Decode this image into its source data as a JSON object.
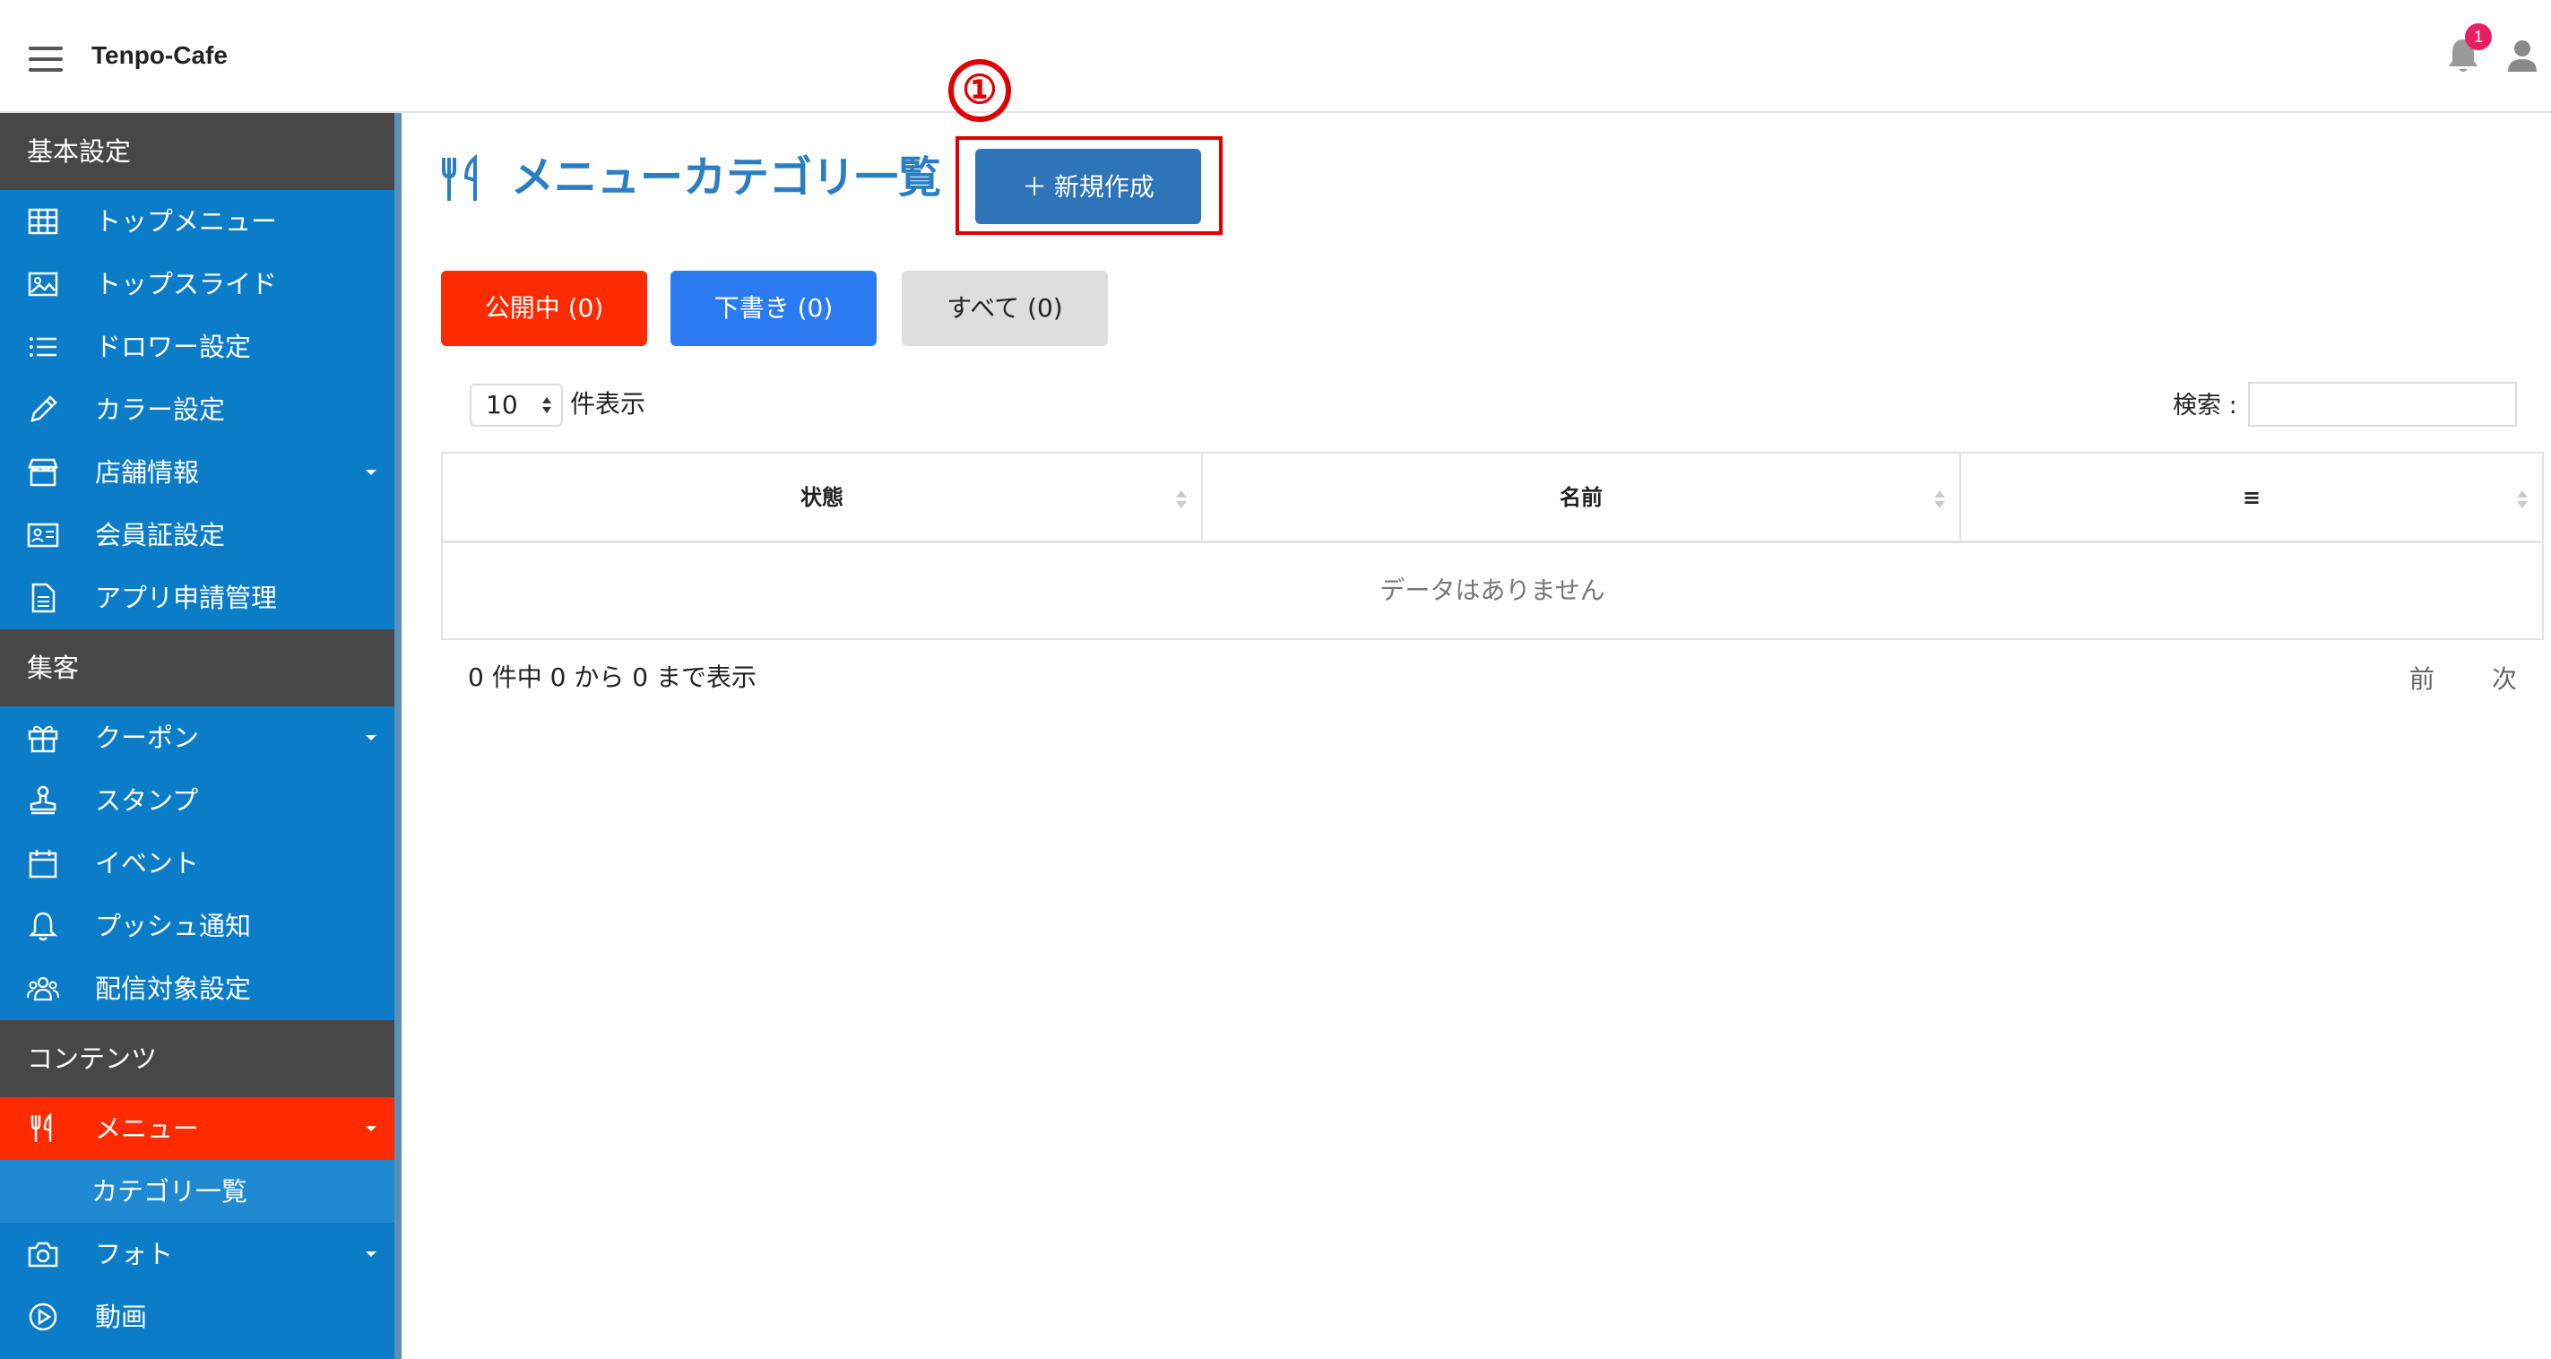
{
  "header": {
    "app_title": "Tenpo-Cafe",
    "notification_count": "1"
  },
  "sidebar": {
    "sections": [
      {
        "title": "基本設定",
        "items": [
          {
            "label": "トップメニュー",
            "icon": "grid-icon"
          },
          {
            "label": "トップスライド",
            "icon": "image-icon"
          },
          {
            "label": "ドロワー設定",
            "icon": "list-icon"
          },
          {
            "label": "カラー設定",
            "icon": "pencil-icon"
          },
          {
            "label": "店舗情報",
            "icon": "store-icon",
            "has_submenu": true
          },
          {
            "label": "会員証設定",
            "icon": "id-card-icon"
          },
          {
            "label": "アプリ申請管理",
            "icon": "document-icon"
          }
        ]
      },
      {
        "title": "集客",
        "items": [
          {
            "label": "クーポン",
            "icon": "gift-icon",
            "has_submenu": true
          },
          {
            "label": "スタンプ",
            "icon": "stamp-icon"
          },
          {
            "label": "イベント",
            "icon": "calendar-icon"
          },
          {
            "label": "プッシュ通知",
            "icon": "bell-icon"
          },
          {
            "label": "配信対象設定",
            "icon": "users-icon"
          }
        ]
      },
      {
        "title": "コンテンツ",
        "items": [
          {
            "label": "メニュー",
            "icon": "fork-knife-icon",
            "has_submenu": true,
            "active": true
          },
          {
            "label": "カテゴリ一覧",
            "submenu": true
          },
          {
            "label": "フォト",
            "icon": "camera-icon",
            "has_submenu": true
          },
          {
            "label": "動画",
            "icon": "play-icon"
          }
        ]
      }
    ]
  },
  "main": {
    "title": "メニューカテゴリ一覧",
    "new_button_label": "＋ 新規作成",
    "annotation": "①",
    "tabs": [
      {
        "label": "公開中 (0)"
      },
      {
        "label": "下書き (0)"
      },
      {
        "label": "すべて (0)"
      }
    ],
    "page_length": "10",
    "page_length_label": "件表示",
    "search_label": "検索 :",
    "search_value": "",
    "table": {
      "columns": [
        "状態",
        "名前",
        "≡"
      ],
      "empty_message": "データはありません"
    },
    "info": "0 件中 0 から 0 まで表示",
    "pager": {
      "prev": "前",
      "next": "次"
    }
  },
  "colors": {
    "sidebar_bg": "#0b7cc7",
    "section_header_bg": "#474747",
    "active_item_bg": "#ff2b00",
    "title_color": "#2a7fc4",
    "primary_button": "#2e74b8",
    "published_tab": "#ff2b00",
    "draft_tab": "#2a7bf2",
    "all_tab": "#dedede",
    "annotation_red": "#e00000"
  }
}
